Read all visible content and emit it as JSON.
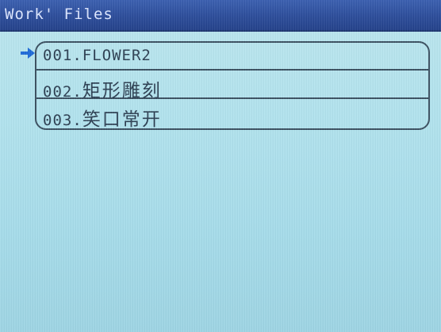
{
  "window": {
    "title": "Work' Files"
  },
  "file_list": {
    "selected_index": 0,
    "items": [
      {
        "number": "001.",
        "name": "FLOWER2"
      },
      {
        "number": "002.",
        "name": "矩形雕刻"
      },
      {
        "number": "003.",
        "name": "笑口常开"
      }
    ]
  },
  "icons": {
    "selection_cursor": "arrow-right-icon"
  },
  "colors": {
    "titlebar": "#2b4c9a",
    "title_text": "#dce6ff",
    "screen_background": "#b2e3ee",
    "row_border": "#3a4f60",
    "text": "#2c3f52",
    "cursor_arrow": "#1e6ad8"
  }
}
